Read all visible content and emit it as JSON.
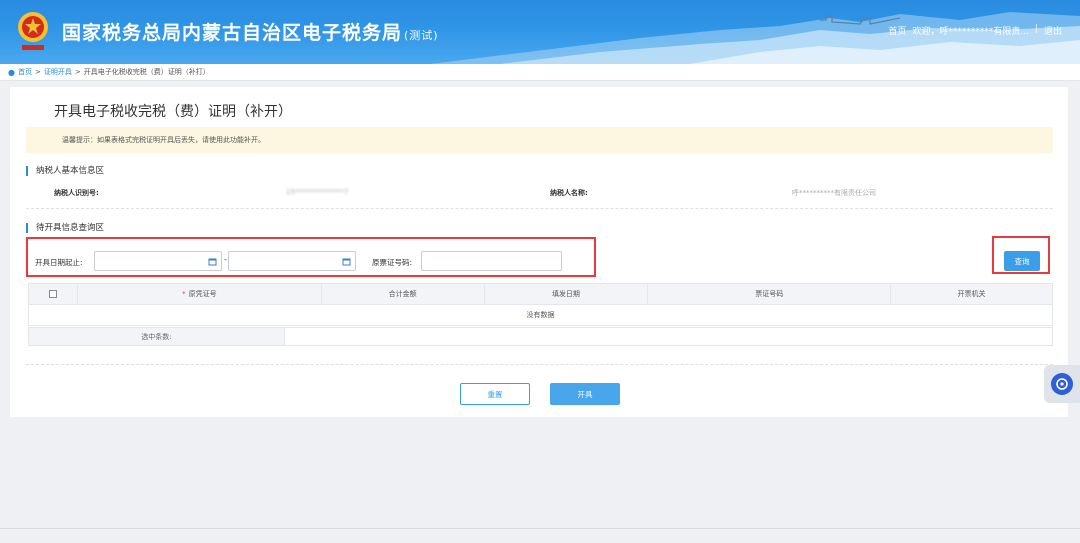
{
  "header": {
    "title": "国家税务总局内蒙古自治区电子税务局",
    "title_tag": "(测试)",
    "nav_home": "首页",
    "nav_welcome": "欢迎，呼**********有限责...",
    "nav_sep": "|",
    "nav_logout": "退出"
  },
  "breadcrumb": {
    "home": "首页",
    "sep1": ">",
    "level1": "证明开具",
    "sep2": ">",
    "current": "开具电子化税收完税（费）证明（补打）"
  },
  "page": {
    "title": "开具电子税收完税（费）证明（补开）",
    "tip": "温馨提示：如果表格式完税证明开具后丢失，请使用此功能补开。"
  },
  "taxpayer_section": {
    "title": "纳税人基本信息区",
    "id_label": "纳税人识别号:",
    "id_value": "15**************7",
    "name_label": "纳税人名称:",
    "name_value": "呼**********有限责任公司"
  },
  "query_section": {
    "title": "待开具信息查询区",
    "date_label": "开具日期起止:",
    "date_separator": "-",
    "date_start": "",
    "date_end": "",
    "voucher_label": "原票证号码:",
    "voucher_value": "",
    "query_button": "查询"
  },
  "table": {
    "columns": [
      "原凭证号",
      "合计金额",
      "填发日期",
      "票证号码",
      "开票机关"
    ],
    "required_marker": "*",
    "empty_text": "没有数据",
    "selected_label": "选中条数:"
  },
  "actions": {
    "reset": "重置",
    "issue": "开具"
  },
  "colors": {
    "primary": "#2a8ce0",
    "highlight_box": "#e83a3a",
    "tip_bg": "#fdf6e1"
  }
}
